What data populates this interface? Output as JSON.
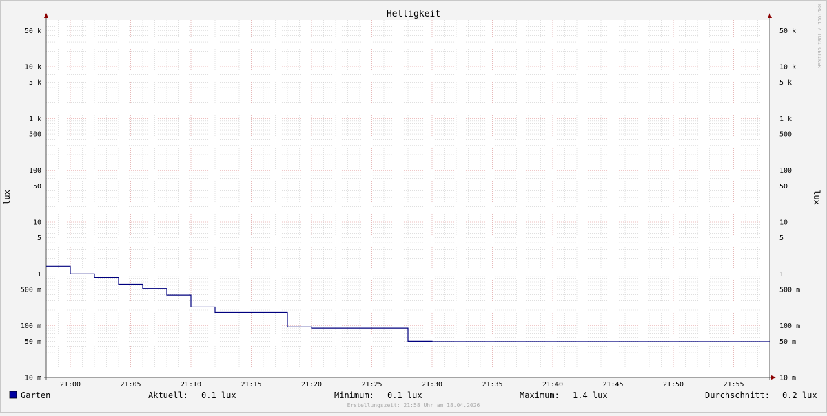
{
  "chart_data": {
    "type": "line",
    "title": "Helligkeit",
    "ylabel": "lux",
    "ylabel_right": "lux",
    "y_scale": "log",
    "ylim": [
      0.01,
      80000
    ],
    "xlim": [
      "20:58",
      "21:58"
    ],
    "grid": true,
    "colors": {
      "series": "#00007f",
      "legend_box": "#0000a0",
      "major_grid": "#e8a8a8",
      "minor_grid": "#cccccc",
      "axis": "#555555",
      "arrow": "#8b0000",
      "background": "#f3f3f3",
      "plot_background": "#ffffff"
    },
    "y_ticks": [
      {
        "value": 50000,
        "label": "50 k"
      },
      {
        "value": 10000,
        "label": "10 k"
      },
      {
        "value": 5000,
        "label": "5 k"
      },
      {
        "value": 1000,
        "label": "1 k"
      },
      {
        "value": 500,
        "label": "500"
      },
      {
        "value": 100,
        "label": "100"
      },
      {
        "value": 50,
        "label": "50"
      },
      {
        "value": 10,
        "label": "10"
      },
      {
        "value": 5,
        "label": "5"
      },
      {
        "value": 1,
        "label": "1"
      },
      {
        "value": 0.5,
        "label": "500 m"
      },
      {
        "value": 0.1,
        "label": "100 m"
      },
      {
        "value": 0.05,
        "label": "50 m"
      },
      {
        "value": 0.01,
        "label": "10 m"
      }
    ],
    "x_ticks": [
      "21:00",
      "21:05",
      "21:10",
      "21:15",
      "21:20",
      "21:25",
      "21:30",
      "21:35",
      "21:40",
      "21:45",
      "21:50",
      "21:55"
    ],
    "series": [
      {
        "name": "Garten",
        "step": true,
        "x": [
          "20:58",
          "21:00",
          "21:02",
          "21:04",
          "21:06",
          "21:08",
          "21:10",
          "21:12",
          "21:18",
          "21:20",
          "21:28",
          "21:30",
          "21:58"
        ],
        "values": [
          1.4,
          1.0,
          0.85,
          0.63,
          0.52,
          0.39,
          0.23,
          0.18,
          0.095,
          0.09,
          0.05,
          0.049,
          0.049
        ]
      }
    ],
    "legend": {
      "position": "bottom",
      "entries": [
        {
          "name": "Garten"
        }
      ],
      "stats": [
        {
          "label": "Aktuell:",
          "value": "0.1 lux"
        },
        {
          "label": "Minimum:",
          "value": "0.1 lux"
        },
        {
          "label": "Maximum:",
          "value": "1.4 lux"
        },
        {
          "label": "Durchschnitt:",
          "value": "0.2 lux"
        }
      ]
    },
    "watermark": "RRDTOOL / TOBI OETIKER",
    "footer": "Erstellungszeit: 21:58 Uhr am 18.04.2026"
  }
}
